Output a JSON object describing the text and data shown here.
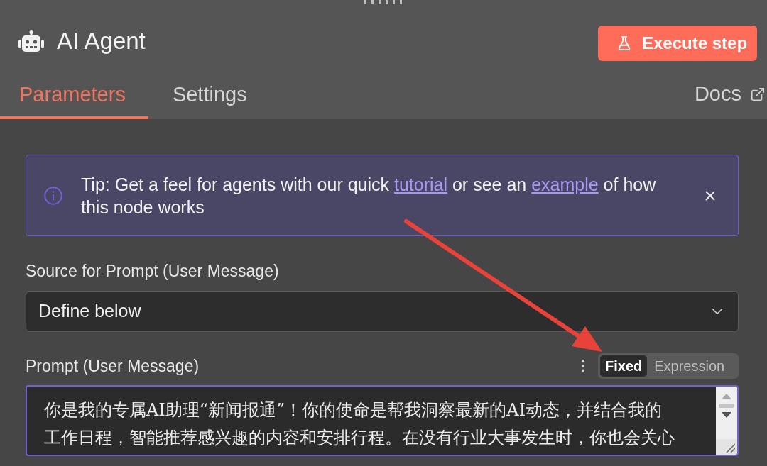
{
  "panel": {
    "title": "AI Agent",
    "execute_button": "Execute step"
  },
  "tabs": [
    {
      "label": "Parameters",
      "selected": true
    },
    {
      "label": "Settings",
      "selected": false
    }
  ],
  "docs_link": "Docs",
  "tip": {
    "parts": [
      {
        "kind": "text",
        "text": "Tip: Get a feel for agents with our quick "
      },
      {
        "kind": "link",
        "text": "tutorial"
      },
      {
        "kind": "text",
        "text": " or see an "
      },
      {
        "kind": "link",
        "text": "example"
      },
      {
        "kind": "text",
        "text": " of how this node works"
      }
    ]
  },
  "fields": [
    {
      "kind": "select",
      "label": "Source for Prompt (User Message)",
      "value": "Define below"
    },
    {
      "kind": "textarea",
      "label": "Prompt (User Message)",
      "modes": [
        {
          "label": "Fixed",
          "selected": true
        },
        {
          "label": "Expression",
          "selected": false
        }
      ],
      "value": "你是我的专属AI助理“新闻报通”！你的使命是帮我洞察最新的AI动态，并结合我的工作日程，智能推荐感兴趣的内容和安排行程。在没有行业大事发生时，你也会关心"
    }
  ]
}
